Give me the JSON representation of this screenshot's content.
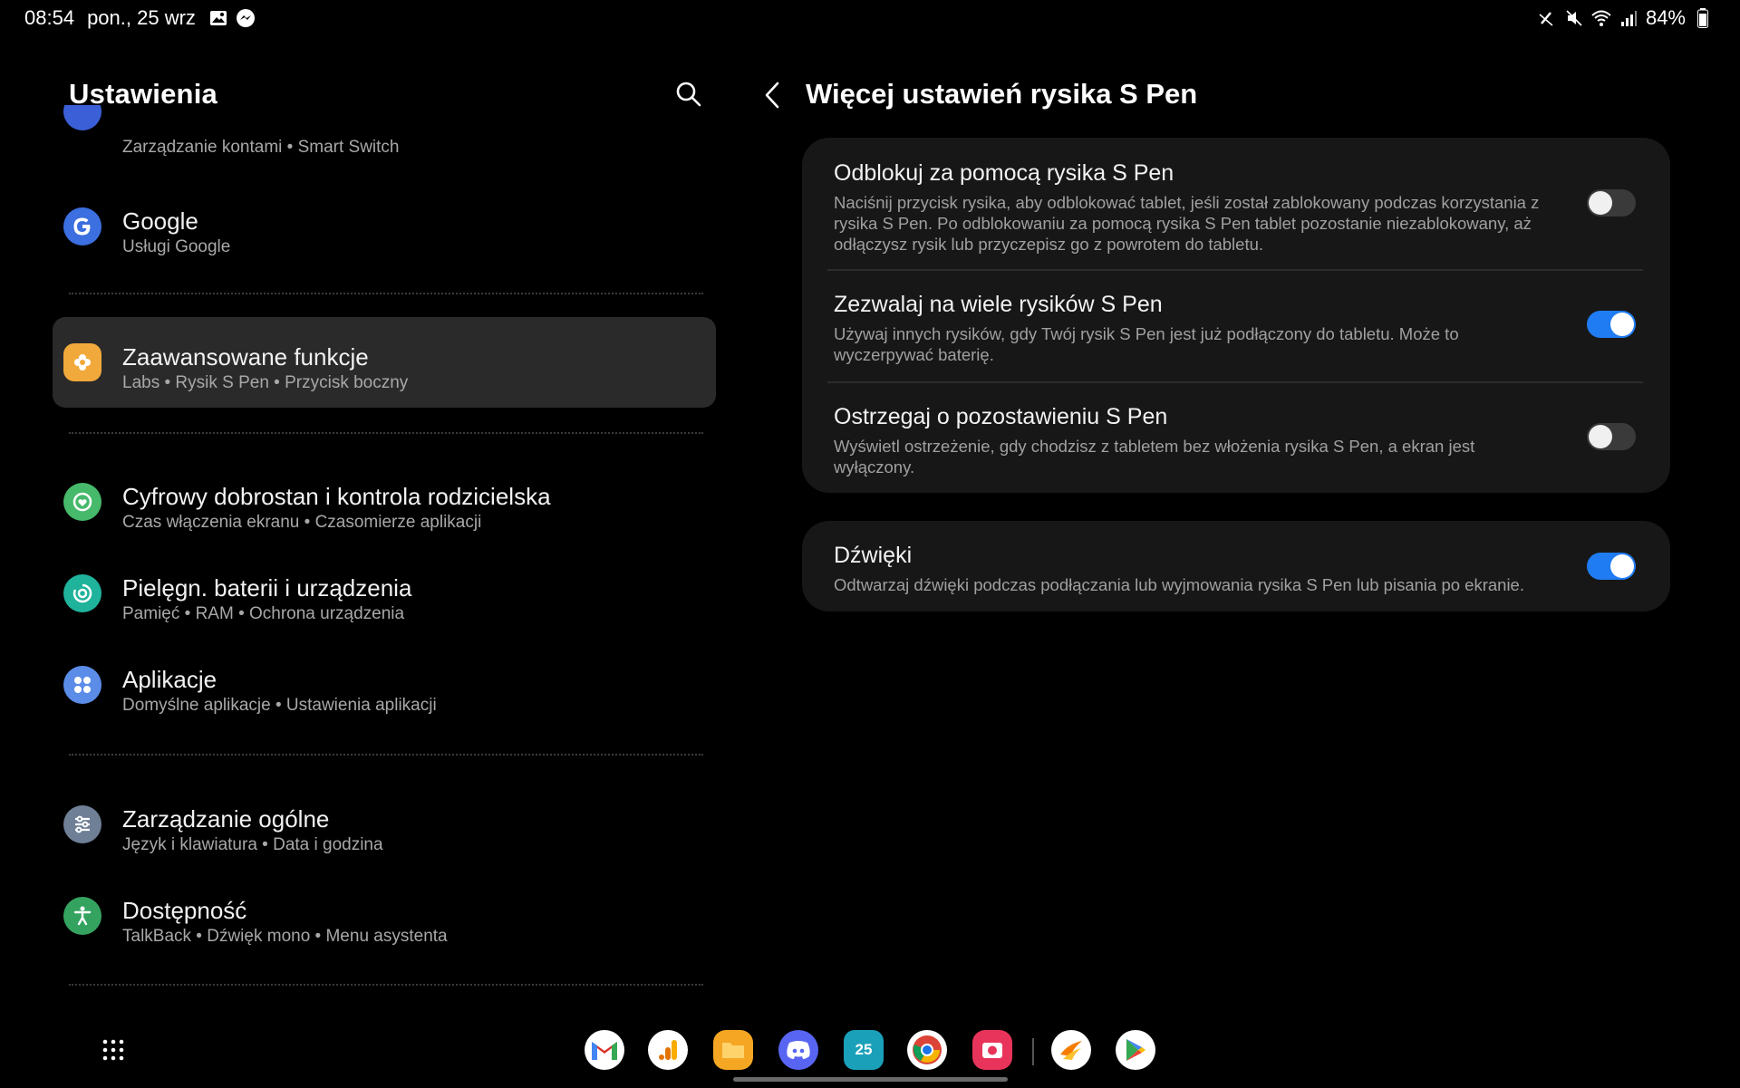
{
  "status_bar": {
    "time": "08:54",
    "date": "pon., 25 wrz",
    "battery": "84%",
    "icons": [
      "gallery-icon",
      "messenger-icon",
      "pen-off-icon",
      "mute-icon",
      "wifi-icon",
      "signal-icon"
    ]
  },
  "left": {
    "title": "Ustawienia",
    "items": [
      {
        "title": "",
        "subtitle": "Zarządzanie kontami  •  Smart Switch",
        "icon": "accounts-icon",
        "color": "#3b5fd6"
      },
      {
        "title": "Google",
        "subtitle": "Usługi Google",
        "icon": "google-icon",
        "color": "#3c6fe0"
      },
      {
        "title": "Zaawansowane funkcje",
        "subtitle": "Labs  •  Rysik S Pen  •  Przycisk boczny",
        "icon": "advanced-features-icon",
        "color": "#f2a93b",
        "active": true
      },
      {
        "title": "Cyfrowy dobrostan i kontrola rodzicielska",
        "subtitle": "Czas włączenia ekranu  •  Czasomierze aplikacji",
        "icon": "wellbeing-icon",
        "color": "#46b96a"
      },
      {
        "title": "Pielęgn. baterii i urządzenia",
        "subtitle": "Pamięć  •  RAM  •  Ochrona urządzenia",
        "icon": "device-care-icon",
        "color": "#1fb39c"
      },
      {
        "title": "Aplikacje",
        "subtitle": "Domyślne aplikacje  •  Ustawienia aplikacji",
        "icon": "apps-icon",
        "color": "#5b8ce8"
      },
      {
        "title": "Zarządzanie ogólne",
        "subtitle": "Język i klawiatura  •  Data i godzina",
        "icon": "general-management-icon",
        "color": "#6f7f96"
      },
      {
        "title": "Dostępność",
        "subtitle": "TalkBack  •  Dźwięk mono  •  Menu asystenta",
        "icon": "accessibility-icon",
        "color": "#35a360"
      }
    ]
  },
  "right": {
    "title": "Więcej ustawień rysika S Pen",
    "card1": [
      {
        "title": "Odblokuj za pomocą rysika S Pen",
        "desc": "Naciśnij przycisk rysika, aby odblokować tablet, jeśli został zablokowany podczas korzystania z rysika S Pen. Po odblokowaniu za pomocą rysika S Pen tablet pozostanie niezablokowany, aż odłączysz rysik lub przyczepisz go z powrotem do tabletu.",
        "on": false
      },
      {
        "title": "Zezwalaj na wiele rysików S Pen",
        "desc": "Używaj innych rysików, gdy Twój rysik S Pen jest już podłączony do tabletu. Może to wyczerpywać baterię.",
        "on": true
      },
      {
        "title": "Ostrzegaj o pozostawieniu S Pen",
        "desc": "Wyświetl ostrzeżenie, gdy chodzisz z tabletem bez włożenia rysika S Pen, a ekran jest wyłączony.",
        "on": false
      }
    ],
    "card2": [
      {
        "title": "Dźwięki",
        "desc": "Odtwarzaj dźwięki podczas podłączania lub wyjmowania rysika S Pen lub pisania po ekranie.",
        "on": true
      }
    ]
  },
  "dock": {
    "apps": [
      {
        "name": "gmail-app",
        "label": "M",
        "bg": "#ffffff",
        "fg": "#d93025"
      },
      {
        "name": "analytics-app",
        "label": "▮",
        "bg": "#ffffff",
        "fg": "#f9ab00"
      },
      {
        "name": "files-app",
        "label": "▬",
        "bg": "#f5a623",
        "fg": "#ffd36b"
      },
      {
        "name": "discord-app",
        "label": "☺",
        "bg": "#5865f2",
        "fg": "#ffffff"
      },
      {
        "name": "calendar-app",
        "label": "25",
        "bg": "#1aa0b8",
        "fg": "#ffffff"
      },
      {
        "name": "chrome-app",
        "label": "◉",
        "bg": "#ffffff",
        "fg": "#1a73e8"
      },
      {
        "name": "screen-recorder-app",
        "label": "◘",
        "bg": "#e8345a",
        "fg": "#ffffff"
      },
      {
        "name": "swiftkey-app",
        "label": "➶",
        "bg": "#ffffff",
        "fg": "#f57c00"
      },
      {
        "name": "play-store-app",
        "label": "▶",
        "bg": "#ffffff",
        "fg": "#34a853"
      }
    ]
  }
}
